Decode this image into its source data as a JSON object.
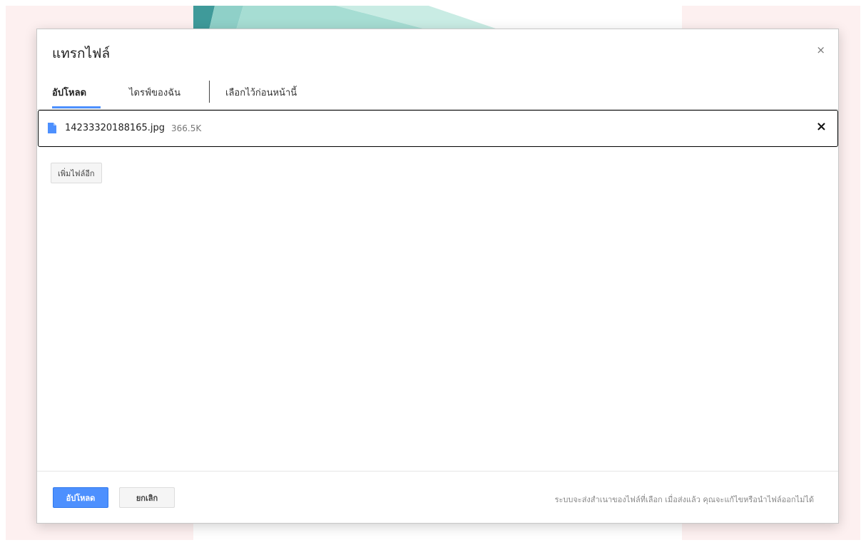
{
  "dialog": {
    "title": "แทรกไฟล์",
    "close_label": "×"
  },
  "tabs": [
    {
      "label": "อัปโหลด",
      "active": true
    },
    {
      "label": "ไดรฟ์ของฉัน",
      "active": false
    },
    {
      "label": "เลือกไว้ก่อนหน้านี้",
      "active": false
    }
  ],
  "file": {
    "icon": "file-icon",
    "name": "14233320188165.jpg",
    "size": "366.5K",
    "remove_label": "×"
  },
  "add_more_label": "เพิ่มไฟล์อีก",
  "footer": {
    "upload_label": "อัปโหลด",
    "cancel_label": "ยกเลิก",
    "note": "ระบบจะส่งสำเนาของไฟล์ที่เลือก เมื่อส่งแล้ว คุณจะแก้ไขหรือนำไฟล์ออกไม่ได้"
  },
  "colors": {
    "accent": "#4d90fe",
    "page_bg_pink": "#fdf0f0",
    "banner_teal": "#8fd0c8"
  }
}
